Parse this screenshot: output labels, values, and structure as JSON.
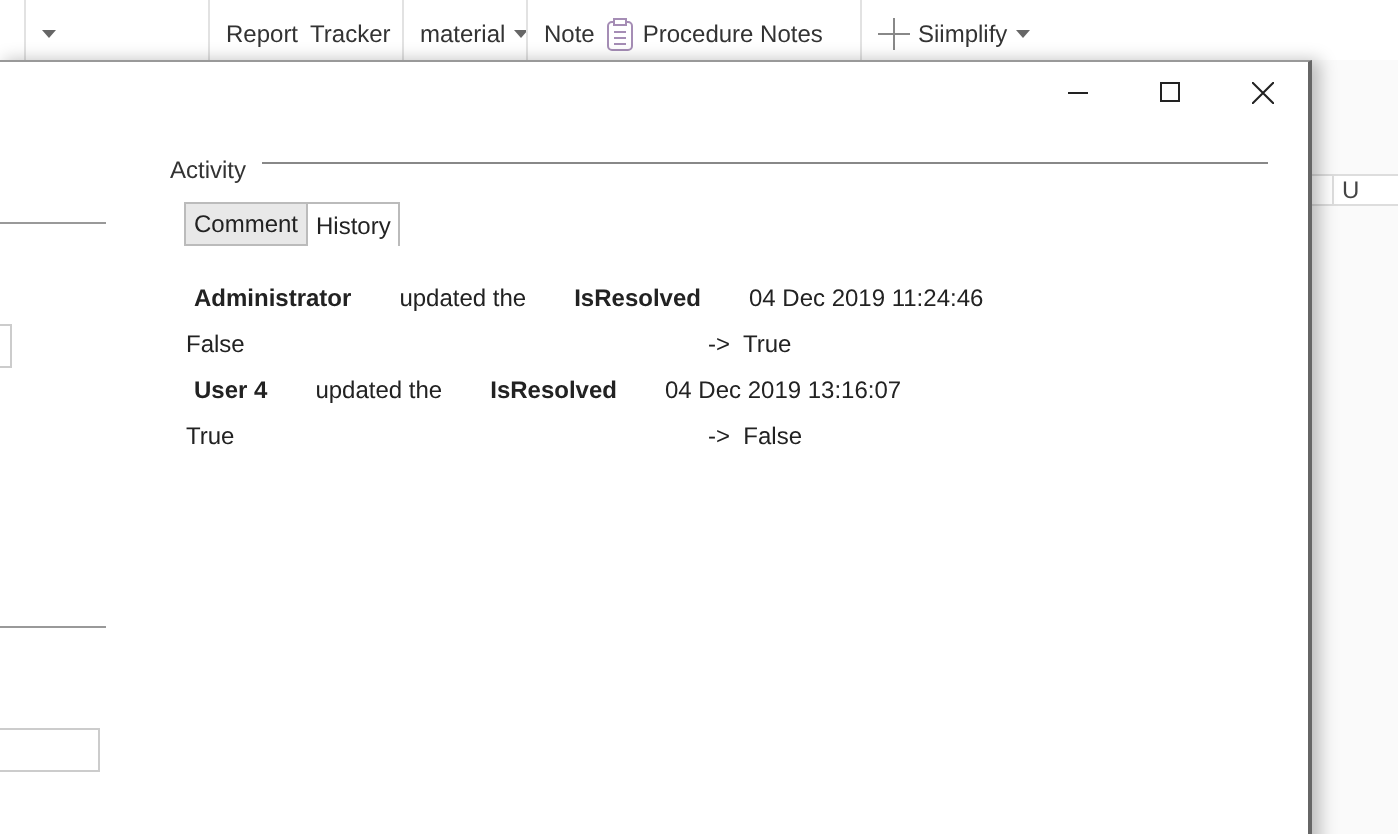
{
  "ribbon": {
    "items": [
      {
        "kind": "caret"
      },
      {
        "kind": "label",
        "label": "Report"
      },
      {
        "kind": "label",
        "label": "Tracker"
      },
      {
        "kind": "dropdown",
        "label": "material"
      },
      {
        "kind": "label",
        "label": "Note"
      },
      {
        "kind": "notes",
        "label": "Procedure Notes"
      },
      {
        "kind": "plus-dropdown",
        "label": "Siimplify"
      }
    ]
  },
  "background_grid": {
    "column_header": "U"
  },
  "dialog": {
    "activity": {
      "title": "Activity",
      "tabs": [
        {
          "label": "Comment",
          "selected": true
        },
        {
          "label": "History",
          "selected": false
        }
      ],
      "entries": [
        {
          "user": "Administrator",
          "action": "updated the",
          "field": "IsResolved",
          "time": "04 Dec 2019 11:24:46",
          "old_value": "False",
          "new_value": "->  True"
        },
        {
          "user": "User 4",
          "action": "updated the",
          "field": "IsResolved",
          "time": "04 Dec 2019 13:16:07",
          "old_value": "True",
          "new_value": "->  False"
        }
      ]
    }
  }
}
